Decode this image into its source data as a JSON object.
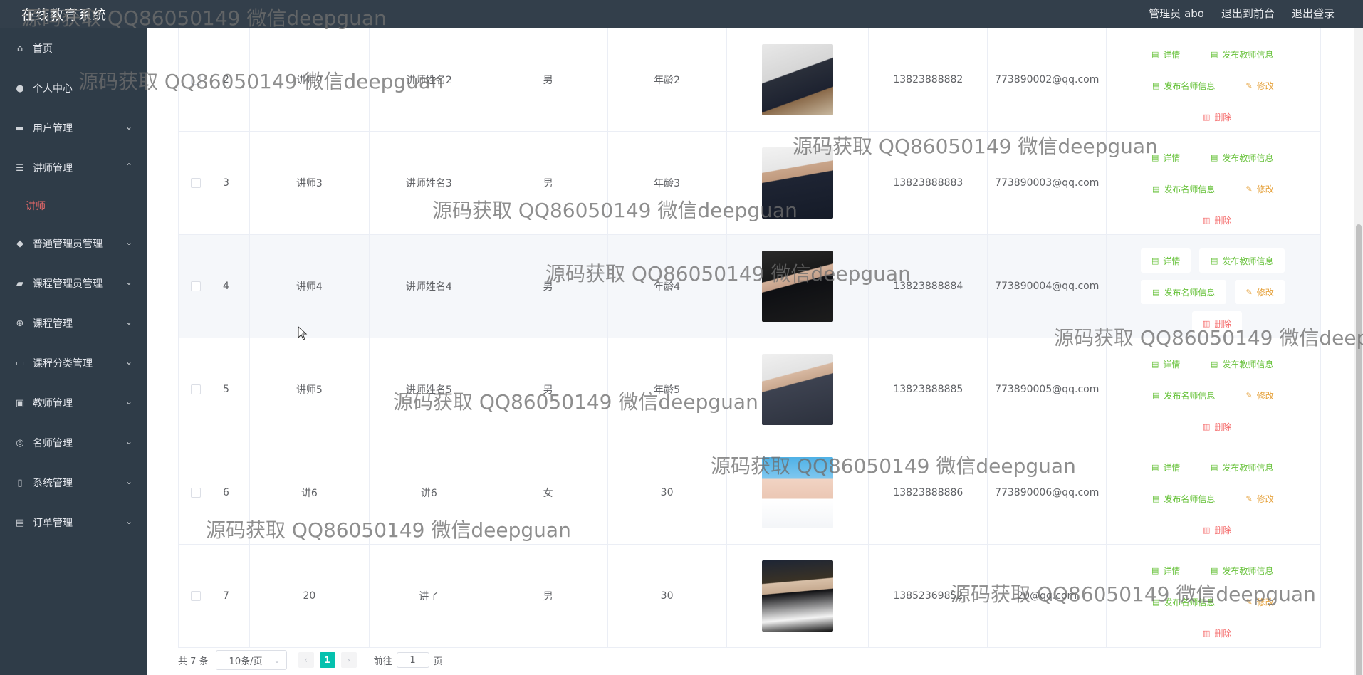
{
  "app": {
    "brand": "在线教育系统",
    "top_links": [
      "管理员 abo",
      "退出到前台",
      "退出登录"
    ]
  },
  "sidebar": {
    "items": [
      {
        "label": "首页",
        "icon": "home-icon",
        "expanded": false
      },
      {
        "label": "个人中心",
        "icon": "user-icon",
        "expanded": false
      },
      {
        "label": "用户管理",
        "icon": "chat-icon",
        "expanded": false
      },
      {
        "label": "讲师管理",
        "icon": "menu-icon",
        "expanded": true,
        "children": [
          "讲师"
        ]
      },
      {
        "label": "普通管理员管理",
        "icon": "location-icon",
        "expanded": false
      },
      {
        "label": "课程管理员管理",
        "icon": "briefcase-icon",
        "expanded": false
      },
      {
        "label": "课程管理",
        "icon": "aim-icon",
        "expanded": false
      },
      {
        "label": "课程分类管理",
        "icon": "ticket-icon",
        "expanded": false
      },
      {
        "label": "教师管理",
        "icon": "bag-icon",
        "expanded": false
      },
      {
        "label": "名师管理",
        "icon": "compass-icon",
        "expanded": false
      },
      {
        "label": "系统管理",
        "icon": "mobile-icon",
        "expanded": false
      },
      {
        "label": "订单管理",
        "icon": "credit-card-icon",
        "expanded": false
      }
    ],
    "active_child": "讲师",
    "active_color": "#f56c6c"
  },
  "table": {
    "rows": [
      {
        "index": "2",
        "account": "讲师2",
        "name": "讲师姓名2",
        "gender": "男",
        "age": "年龄2",
        "photo": "man in navy suit seated on stool",
        "phone": "13823888882",
        "email": "773890002@qq.com"
      },
      {
        "index": "3",
        "account": "讲师3",
        "name": "讲师姓名3",
        "gender": "男",
        "age": "年龄3",
        "photo": "man in dark suit with tie",
        "phone": "13823888883",
        "email": "773890003@qq.com"
      },
      {
        "index": "4",
        "account": "讲师4",
        "name": "讲师姓名4",
        "gender": "男",
        "age": "年龄4",
        "photo": "man in dark suit seated",
        "phone": "13823888884",
        "email": "773890004@qq.com"
      },
      {
        "index": "5",
        "account": "讲师5",
        "name": "讲师姓名5",
        "gender": "男",
        "age": "年龄5",
        "photo": "man in grey suit seated",
        "phone": "13823888885",
        "email": "773890005@qq.com"
      },
      {
        "index": "6",
        "account": "讲6",
        "name": "讲6",
        "gender": "女",
        "age": "30",
        "photo": "smiling woman on blue background",
        "phone": "13823888886",
        "email": "773890006@qq.com"
      },
      {
        "index": "7",
        "account": "20",
        "name": "讲了",
        "gender": "男",
        "age": "30",
        "photo": "man at night with lights",
        "phone": "13852369852",
        "email": "20@qq.com"
      }
    ],
    "hover_row": "4",
    "actions": {
      "detail": "详情",
      "publish_teacher": "发布教师信息",
      "publish_famous": "发布名师信息",
      "edit": "修改",
      "delete": "删除"
    },
    "colors": {
      "green": "#67c23a",
      "orange": "#e6a23c",
      "red": "#f56c6c"
    }
  },
  "pagination": {
    "total": "共 7 条",
    "page_size": "10条/页",
    "current_page": "1",
    "goto_label": "前往",
    "goto_value": "1",
    "page_suffix": "页",
    "accent": "#05c1ae"
  },
  "watermark": {
    "text": "源码获取 QQ86050149 微信deepguan"
  }
}
